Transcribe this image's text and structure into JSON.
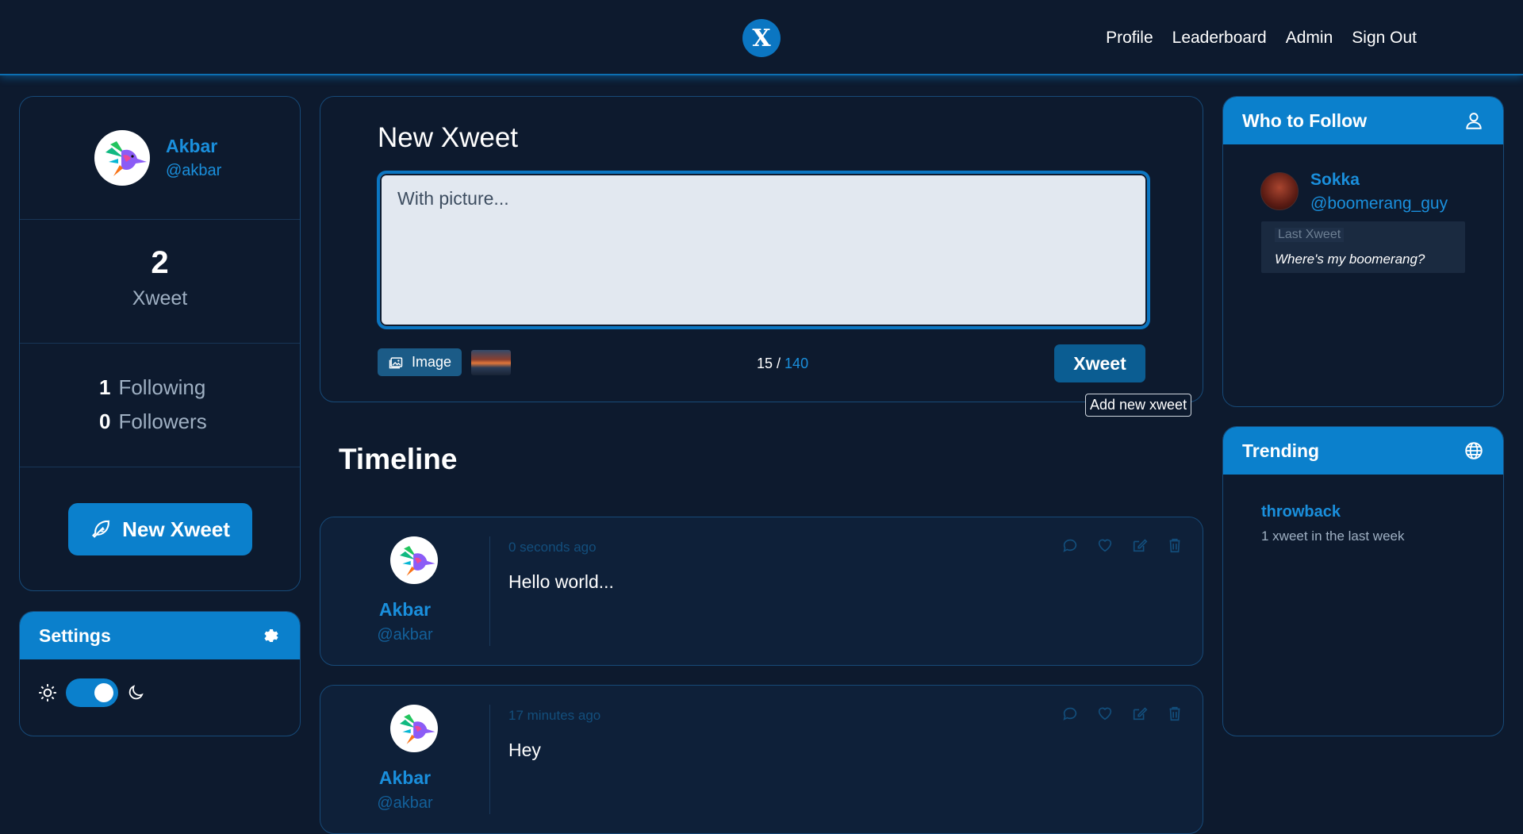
{
  "header": {
    "logo_letter": "X",
    "nav": [
      "Profile",
      "Leaderboard",
      "Admin",
      "Sign Out"
    ]
  },
  "profile": {
    "name": "Akbar",
    "handle": "@akbar",
    "xweet_count": "2",
    "xweet_label": "Xweet",
    "following_count": "1",
    "following_label": "Following",
    "followers_count": "0",
    "followers_label": "Followers",
    "new_xweet_label": "New Xweet"
  },
  "settings": {
    "title": "Settings",
    "dark_mode": true
  },
  "composer": {
    "title": "New Xweet",
    "text": "With picture...",
    "image_label": "Image",
    "char_count": "15",
    "char_separator": " / ",
    "char_max": "140",
    "submit_label": "Xweet",
    "tooltip": "Add new xweet"
  },
  "timeline": {
    "title": "Timeline",
    "posts": [
      {
        "name": "Akbar",
        "handle": "@akbar",
        "time": "0 seconds ago",
        "text": "Hello world..."
      },
      {
        "name": "Akbar",
        "handle": "@akbar",
        "time": "17 minutes ago",
        "text": "Hey"
      }
    ]
  },
  "who_to_follow": {
    "title": "Who to Follow",
    "users": [
      {
        "name": "Sokka",
        "handle": "@boomerang_guy",
        "last_label": "Last Xweet",
        "last_text": "Where's my boomerang?"
      }
    ]
  },
  "trending": {
    "title": "Trending",
    "items": [
      {
        "tag": "throwback",
        "count": "1 xweet in the last week"
      }
    ]
  },
  "colors": {
    "background": "#0d1a2e",
    "accent": "#0b80cc",
    "link": "#1a8fdc",
    "border": "#174a78"
  }
}
